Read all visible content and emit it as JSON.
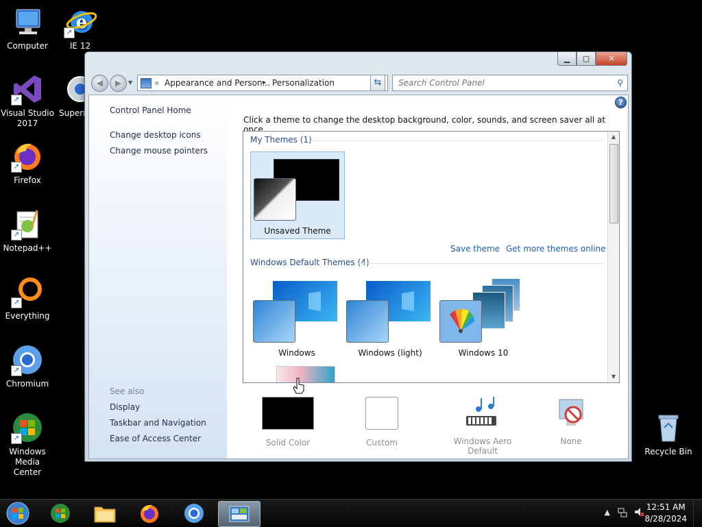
{
  "desktop": {
    "icons": [
      {
        "label": "Computer",
        "icon": "computer-icon"
      },
      {
        "label": "IE 12",
        "icon": "internet-explorer-icon"
      },
      {
        "label": "Visual Studio 2017",
        "icon": "visual-studio-icon"
      },
      {
        "label": "Superm",
        "icon": "superm-icon"
      },
      {
        "label": "Firefox",
        "icon": "firefox-icon"
      },
      {
        "label": "Notepad++",
        "icon": "notepad-plus-plus-icon"
      },
      {
        "label": "Everything",
        "icon": "everything-icon"
      },
      {
        "label": "Chromium",
        "icon": "chromium-icon"
      },
      {
        "label": "Windows Media Center",
        "icon": "windows-media-center-icon"
      },
      {
        "label": "Recycle Bin",
        "icon": "recycle-bin-icon"
      }
    ]
  },
  "window": {
    "address": {
      "prefix": "«",
      "crumb1": "Appearance and Person...",
      "sep": "▸",
      "crumb2": "Personalization"
    },
    "search_placeholder": "Search Control Panel",
    "left": {
      "home": "Control Panel Home",
      "link1": "Change desktop icons",
      "link2": "Change mouse pointers",
      "see_also": "See also",
      "see1": "Display",
      "see2": "Taskbar and Navigation",
      "see3": "Ease of Access Center"
    },
    "intro": "Click a theme to change the desktop background, color, sounds, and screen saver all at once.",
    "my_themes": {
      "header": "My Themes (1)",
      "items": [
        {
          "label": "Unsaved Theme"
        }
      ]
    },
    "save_theme": "Save theme",
    "get_more": "Get more themes online",
    "default_themes": {
      "header": "Windows Default Themes (4)",
      "items": [
        {
          "label": "Windows"
        },
        {
          "label": "Windows (light)"
        },
        {
          "label": "Windows 10"
        }
      ]
    },
    "bottom": {
      "solid": "Solid Color",
      "custom": "Custom",
      "aero": "Windows Aero Default",
      "none": "None"
    }
  },
  "taskbar": {
    "time": "12:51 AM",
    "date": "8/28/2024"
  }
}
